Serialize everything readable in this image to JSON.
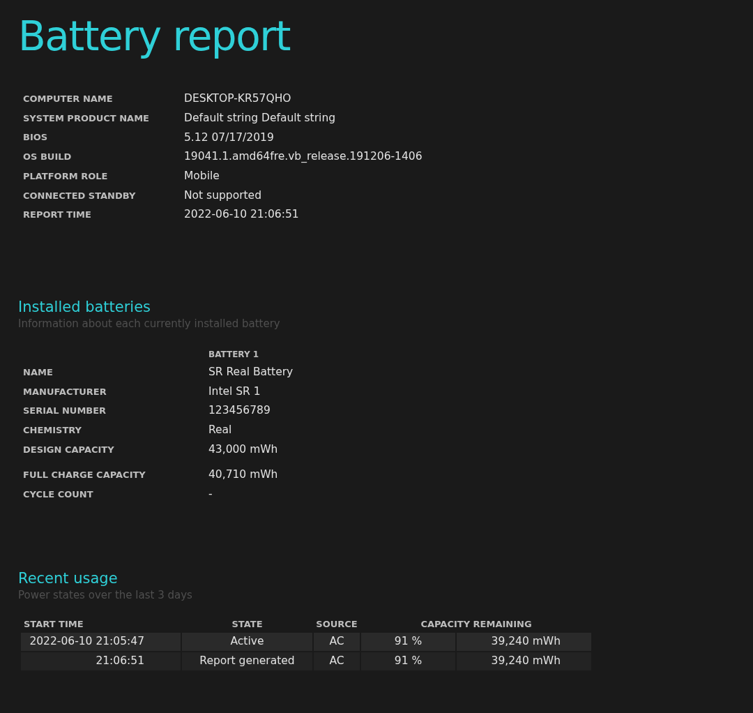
{
  "title": "Battery report",
  "system_info": [
    {
      "label": "COMPUTER NAME",
      "value": "DESKTOP-KR57QHO"
    },
    {
      "label": "SYSTEM PRODUCT NAME",
      "value": "Default string Default string"
    },
    {
      "label": "BIOS",
      "value": "5.12 07/17/2019"
    },
    {
      "label": "OS BUILD",
      "value": "19041.1.amd64fre.vb_release.191206-1406"
    },
    {
      "label": "PLATFORM ROLE",
      "value": "Mobile"
    },
    {
      "label": "CONNECTED STANDBY",
      "value": "Not supported"
    },
    {
      "label": "REPORT TIME",
      "value": "2022-06-10  21:06:51"
    }
  ],
  "installed_batteries": {
    "heading": "Installed batteries",
    "subtitle": "Information about each currently installed battery",
    "column_header": "BATTERY 1",
    "rows": [
      {
        "label": "NAME",
        "value": "SR Real Battery"
      },
      {
        "label": "MANUFACTURER",
        "value": "Intel SR 1"
      },
      {
        "label": "SERIAL NUMBER",
        "value": "123456789"
      },
      {
        "label": "CHEMISTRY",
        "value": "Real"
      },
      {
        "label": "DESIGN CAPACITY",
        "value": "43,000 mWh"
      },
      {
        "label": "FULL CHARGE CAPACITY",
        "value": "40,710 mWh"
      },
      {
        "label": "CYCLE COUNT",
        "value": "-"
      }
    ]
  },
  "recent_usage": {
    "heading": "Recent usage",
    "subtitle": "Power states over the last 3 days",
    "columns": [
      "START TIME",
      "STATE",
      "SOURCE",
      "CAPACITY REMAINING"
    ],
    "rows": [
      {
        "start_time": "2022-06-10  21:05:47",
        "state": "Active",
        "source": "AC",
        "percent": "91 %",
        "capacity": "39,240 mWh"
      },
      {
        "start_time": "21:06:51",
        "state": "Report generated",
        "source": "AC",
        "percent": "91 %",
        "capacity": "39,240 mWh"
      }
    ]
  }
}
